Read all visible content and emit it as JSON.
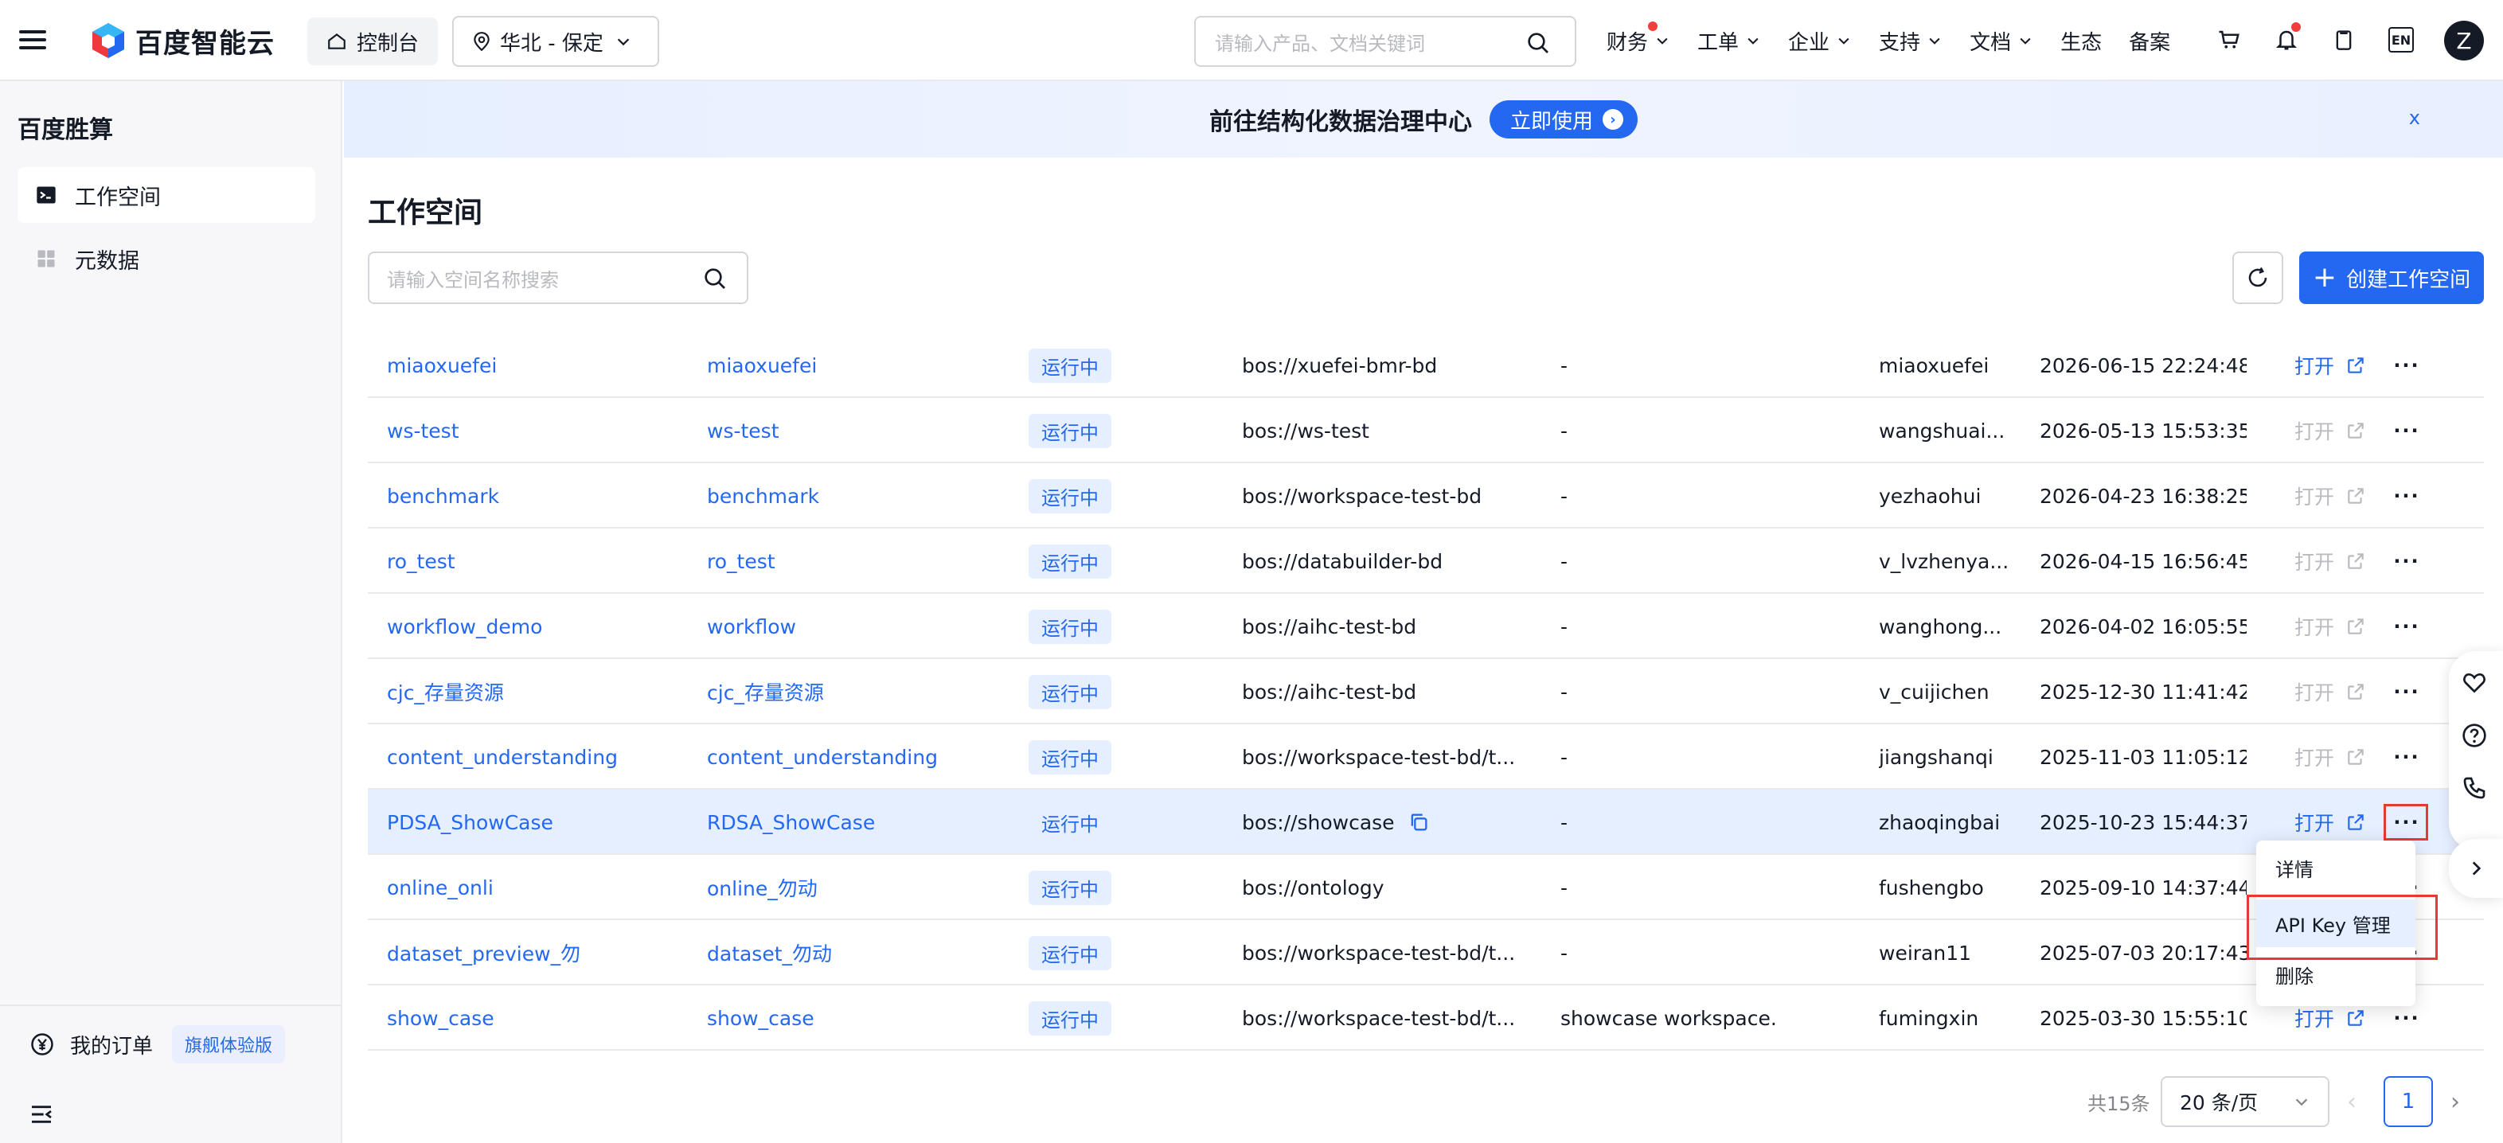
{
  "header": {
    "brand": "百度智能云",
    "console": "控制台",
    "region": "华北 - 保定",
    "search_placeholder": "请输入产品、文档关键词",
    "nav": [
      {
        "label": "财务",
        "has_dot": true
      },
      {
        "label": "工单"
      },
      {
        "label": "企业"
      },
      {
        "label": "支持"
      },
      {
        "label": "文档"
      },
      {
        "label": "生态"
      },
      {
        "label": "备案"
      }
    ],
    "lang": "EN",
    "avatar": "Z"
  },
  "sidebar": {
    "title": "百度胜算",
    "items": [
      {
        "label": "工作空间",
        "active": true
      },
      {
        "label": "元数据",
        "active": false
      }
    ],
    "order_label": "我的订单",
    "order_badge": "旗舰体验版"
  },
  "banner": {
    "text": "前往结构化数据治理中心",
    "button": "立即使用",
    "close": "x"
  },
  "main": {
    "title": "工作空间",
    "search_placeholder": "请输入空间名称搜索",
    "create_button": "创建工作空间"
  },
  "table": {
    "rows": [
      {
        "name": "miaoxuefei",
        "id": "miaoxuefei",
        "status": "运行中",
        "bos": "bos://xuefei-bmr-bd",
        "desc": "-",
        "owner": "miaoxuefei",
        "time": "2026-06-15 22:24:48",
        "open": "打开",
        "open_enabled": true
      },
      {
        "name": "ws-test",
        "id": "ws-test",
        "status": "运行中",
        "bos": "bos://ws-test",
        "desc": "-",
        "owner": "wangshuai...",
        "time": "2026-05-13 15:53:35",
        "open": "打开",
        "open_enabled": false
      },
      {
        "name": "benchmark",
        "id": "benchmark",
        "status": "运行中",
        "bos": "bos://workspace-test-bd",
        "desc": "-",
        "owner": "yezhaohui",
        "time": "2026-04-23 16:38:25",
        "open": "打开",
        "open_enabled": false
      },
      {
        "name": "ro_test",
        "id": "ro_test",
        "status": "运行中",
        "bos": "bos://databuilder-bd",
        "desc": "-",
        "owner": "v_lvzhenya...",
        "time": "2026-04-15 16:56:45",
        "open": "打开",
        "open_enabled": false
      },
      {
        "name": "workflow_demo",
        "id": "workflow",
        "status": "运行中",
        "bos": "bos://aihc-test-bd",
        "desc": "-",
        "owner": "wanghong...",
        "time": "2026-04-02 16:05:55",
        "open": "打开",
        "open_enabled": false
      },
      {
        "name": "cjc_存量资源",
        "id": "cjc_存量资源",
        "status": "运行中",
        "bos": "bos://aihc-test-bd",
        "desc": "-",
        "owner": "v_cuijichen",
        "time": "2025-12-30 11:41:42",
        "open": "打开",
        "open_enabled": false
      },
      {
        "name": "content_understanding",
        "id": "content_understanding",
        "status": "运行中",
        "bos": "bos://workspace-test-bd/t...",
        "desc": "-",
        "owner": "jiangshanqi",
        "time": "2025-11-03 11:05:12",
        "open": "打开",
        "open_enabled": false
      },
      {
        "name": "PDSA_ShowCase",
        "id": "RDSA_ShowCase",
        "status": "运行中",
        "bos": "bos://showcase",
        "desc": "-",
        "owner": "zhaoqingbai",
        "time": "2025-10-23 15:44:37",
        "open": "打开",
        "open_enabled": true,
        "highlight": true
      },
      {
        "name": "online_onli",
        "id": "online_勿动",
        "status": "运行中",
        "bos": "bos://ontology",
        "desc": "-",
        "owner": "fushengbo",
        "time": "2025-09-10 14:37:44",
        "open": "打开",
        "open_enabled": false
      },
      {
        "name": "dataset_preview_勿",
        "id": "dataset_勿动",
        "status": "运行中",
        "bos": "bos://workspace-test-bd/t...",
        "desc": "-",
        "owner": "weiran11",
        "time": "2025-07-03 20:17:43",
        "open": "打开",
        "open_enabled": false
      },
      {
        "name": "show_case",
        "id": "show_case",
        "status": "运行中",
        "bos": "bos://workspace-test-bd/t...",
        "desc": "showcase workspace.",
        "owner": "fumingxin",
        "time": "2025-03-30 15:55:10",
        "open": "打开",
        "open_enabled": true
      }
    ]
  },
  "menu": {
    "items": [
      "详情",
      "API Key 管理",
      "删除"
    ]
  },
  "pagination": {
    "total": "共15条",
    "page_size": "20 条/页",
    "current": "1"
  },
  "colors": {
    "primary": "#2468f2",
    "highlight": "#e53935",
    "row_highlight": "#e6efff"
  }
}
